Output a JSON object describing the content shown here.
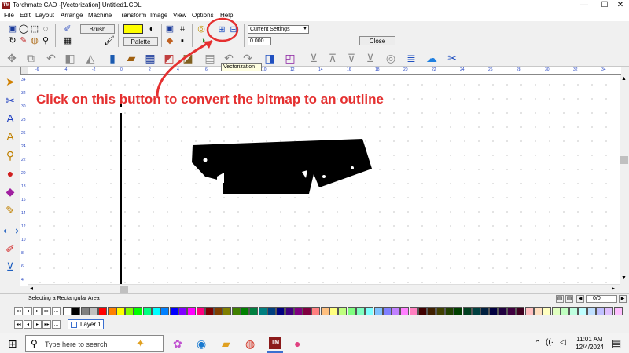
{
  "window": {
    "title": "Torchmate CAD -[Vectorization] Untitled1.CDL",
    "app_icon_text": "TM",
    "minimize": "—",
    "maximize": "☐",
    "close": "✕"
  },
  "menu": [
    "File",
    "Edit",
    "Layout",
    "Arrange",
    "Machine",
    "Transform",
    "Image",
    "View",
    "Options",
    "Help"
  ],
  "toolbar": {
    "brush_label": "Brush",
    "palette_label": "Palette",
    "settings_select_value": "Current Settings",
    "value_field": "0.000",
    "close_label": "Close",
    "tooltip": "Vectorization"
  },
  "annotation": {
    "text": "Click on this button to convert the bitmap to an outline",
    "color": "#e53030"
  },
  "rulers": {
    "h_ticks": [
      "-6",
      "-4",
      "-2",
      "0",
      "2",
      "4",
      "6",
      "8",
      "10",
      "12",
      "14",
      "16",
      "18",
      "20",
      "22",
      "24",
      "26",
      "28",
      "30",
      "32",
      "34"
    ],
    "v_ticks": [
      "34",
      "32",
      "30",
      "28",
      "26",
      "24",
      "22",
      "20",
      "18",
      "16",
      "14",
      "12",
      "10",
      "8",
      "6",
      "4"
    ]
  },
  "status": {
    "text": "Selecting a Rectangular Area",
    "page_counter": "0/0"
  },
  "layers": {
    "active_layer": "Layer 1"
  },
  "palette_colors": [
    "#ffffff",
    "#000000",
    "#808080",
    "#c0c0c0",
    "#ff0000",
    "#ff8000",
    "#ffff00",
    "#80ff00",
    "#00ff00",
    "#00ff80",
    "#00ffff",
    "#0080ff",
    "#0000ff",
    "#8000ff",
    "#ff00ff",
    "#ff0080",
    "#800000",
    "#804000",
    "#808000",
    "#408000",
    "#008000",
    "#008040",
    "#008080",
    "#004080",
    "#000080",
    "#400080",
    "#800080",
    "#800040",
    "#ff8080",
    "#ffc080",
    "#ffff80",
    "#c0ff80",
    "#80ff80",
    "#80ffc0",
    "#80ffff",
    "#80c0ff",
    "#8080ff",
    "#c080ff",
    "#ff80ff",
    "#ff80c0",
    "#400000",
    "#402000",
    "#404000",
    "#204000",
    "#004000",
    "#004020",
    "#004040",
    "#002040",
    "#000040",
    "#200040",
    "#400040",
    "#400020",
    "#ffc0c0",
    "#ffe0c0",
    "#ffffc0",
    "#e0ffc0",
    "#c0ffc0",
    "#c0ffe0",
    "#c0ffff",
    "#c0e0ff",
    "#c0c0ff",
    "#e0c0ff",
    "#ffc0ff"
  ],
  "taskbar": {
    "search_placeholder": "Type here to search",
    "time": "11:01 AM",
    "date": "12/4/2024"
  }
}
